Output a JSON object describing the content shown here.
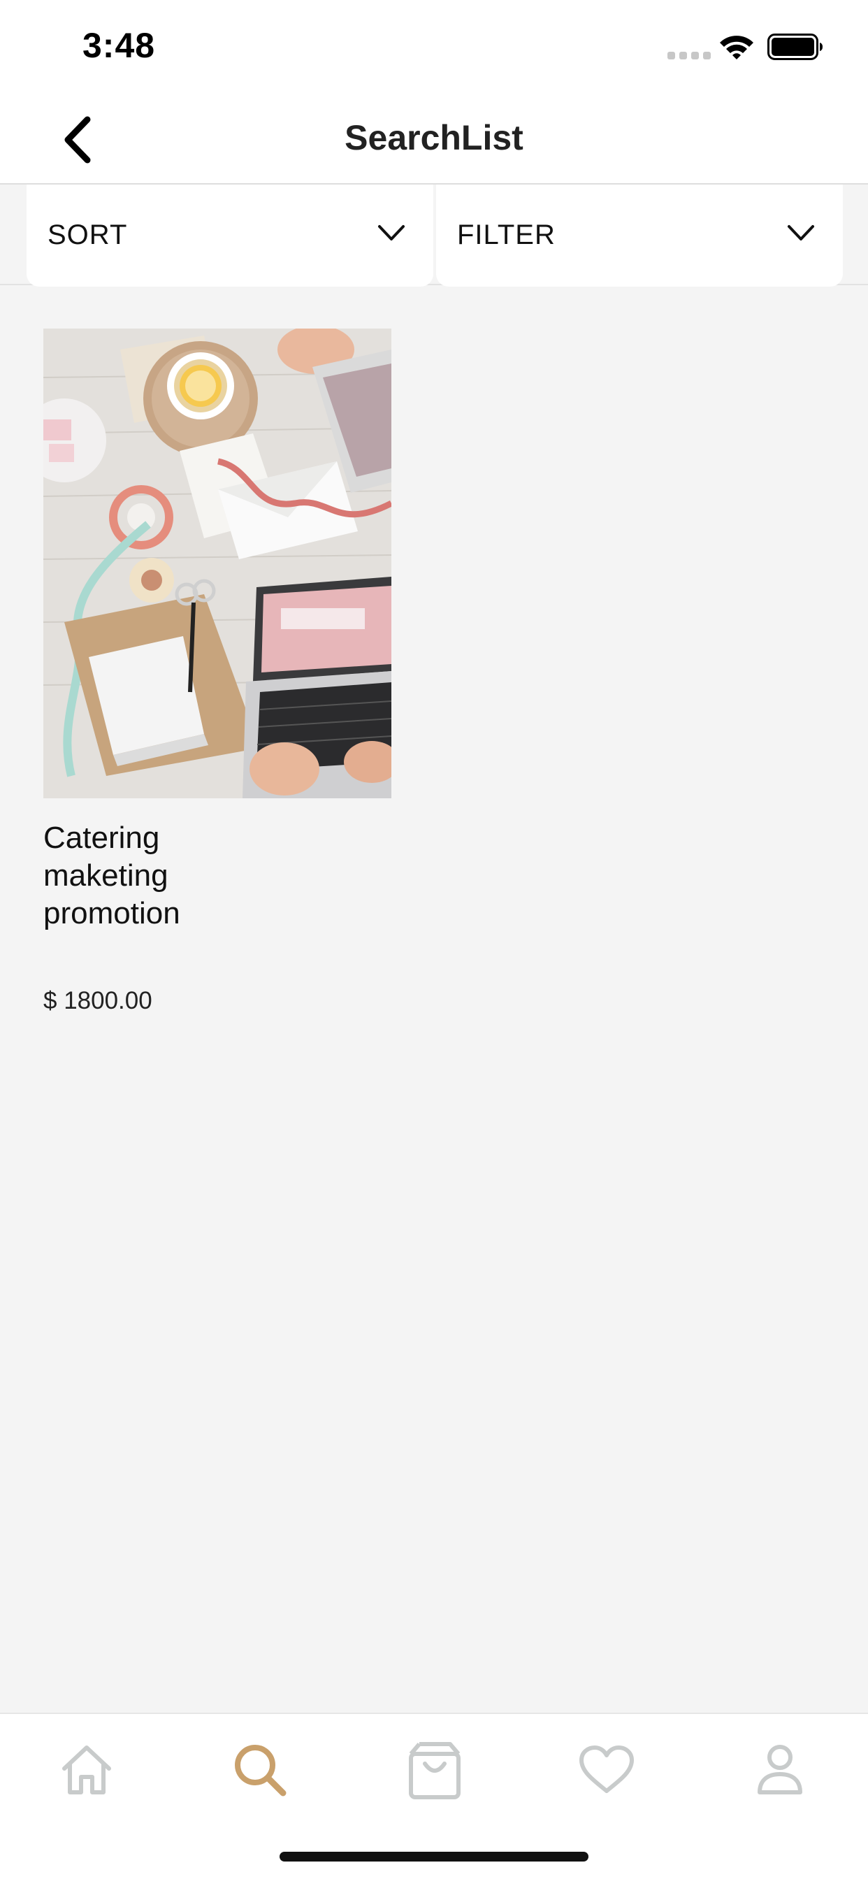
{
  "status_bar": {
    "time": "3:48"
  },
  "nav": {
    "title": "SearchList",
    "back_icon": "chevron-left-icon"
  },
  "controls": {
    "sort_label": "SORT",
    "filter_label": "FILTER"
  },
  "products": [
    {
      "title": "Catering maketing promotion",
      "price": "$ 1800.00",
      "image": "desk-flatlay-photo"
    }
  ],
  "tab_bar": {
    "items": [
      {
        "name": "home",
        "icon": "home-icon",
        "active": false
      },
      {
        "name": "search",
        "icon": "search-icon",
        "active": true
      },
      {
        "name": "bag",
        "icon": "shopping-bag-icon",
        "active": false
      },
      {
        "name": "favorites",
        "icon": "heart-icon",
        "active": false
      },
      {
        "name": "profile",
        "icon": "user-icon",
        "active": false
      }
    ],
    "active_color": "#c9a06b",
    "inactive_color": "#c8cbcb"
  }
}
